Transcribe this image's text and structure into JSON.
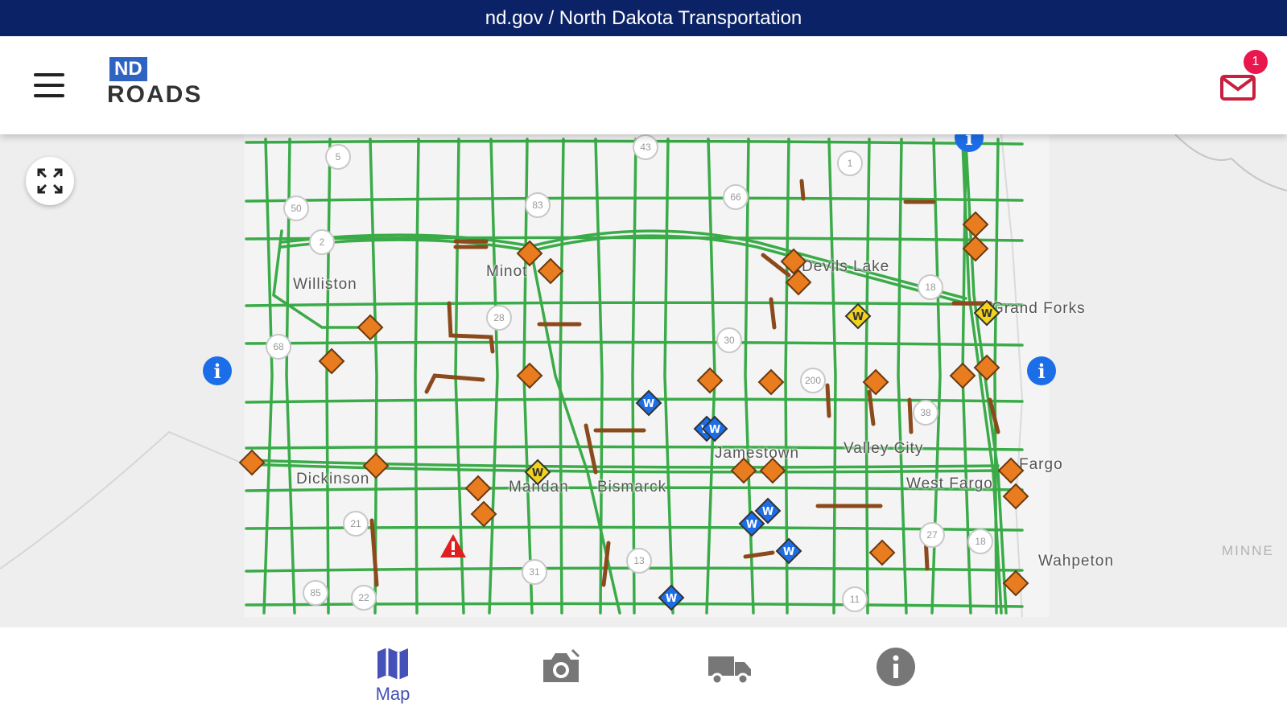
{
  "url_bar": {
    "text": "nd.gov / North Dakota Transportation"
  },
  "header": {
    "logo": {
      "top": "ND",
      "bottom": "ROADS"
    },
    "notifications": {
      "count": "1"
    }
  },
  "map": {
    "cities": [
      "Williston",
      "Minot",
      "Devils Lake",
      "Grand Forks",
      "Dickinson",
      "Mandan",
      "Bismarck",
      "Jamestown",
      "Valley City",
      "West Fargo",
      "Fargo",
      "Wahpeton"
    ],
    "shields": [
      "5",
      "43",
      "1",
      "50",
      "83",
      "66",
      "2",
      "18",
      "28",
      "30",
      "68",
      "200",
      "38",
      "21",
      "27",
      "18",
      "85",
      "22",
      "31",
      "13",
      "11"
    ],
    "neighbor_state": "MINNE",
    "info_marker": "i",
    "colors": {
      "road_ok": "#3aab48",
      "road_restricted": "#8b4a1c",
      "incident": "#e87c1e",
      "warning": "#f2d21b",
      "weather": "#1c6ee8",
      "alert": "#e02020"
    }
  },
  "bottom_nav": {
    "tabs": [
      {
        "label": "Map",
        "icon": "map-icon",
        "active": true
      },
      {
        "label": "",
        "icon": "camera-icon",
        "active": false
      },
      {
        "label": "",
        "icon": "truck-icon",
        "active": false
      },
      {
        "label": "",
        "icon": "info-icon",
        "active": false
      }
    ]
  }
}
